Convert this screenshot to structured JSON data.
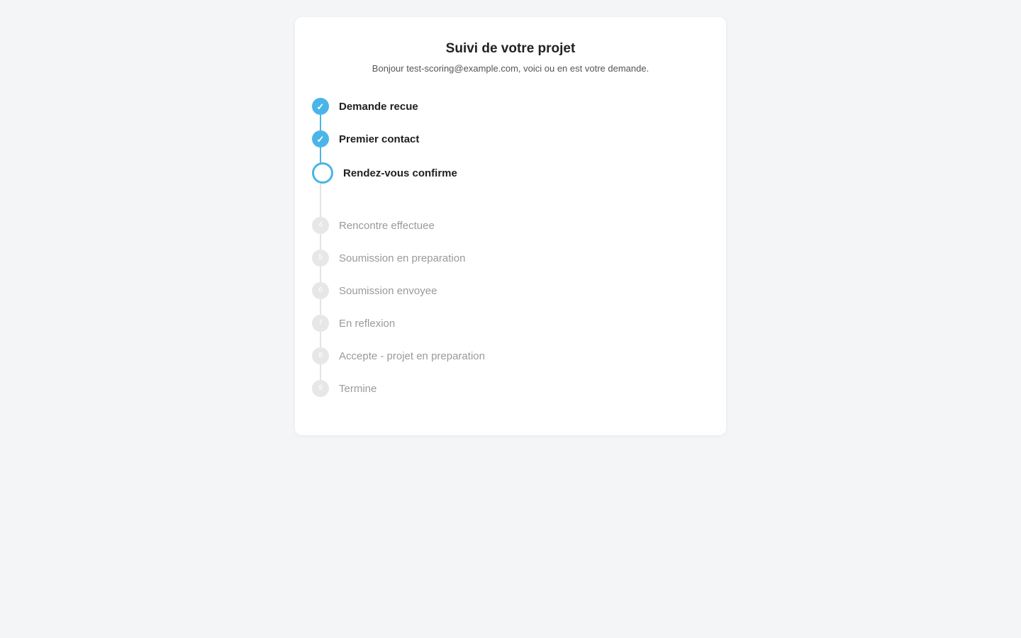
{
  "page": {
    "title": "Suivi de votre projet",
    "subtitle": "Bonjour test-scoring@example.com, voici ou en est votre demande."
  },
  "colors": {
    "accent": "#4ab5e8",
    "background": "#f4f5f7",
    "card": "#ffffff",
    "inactive_dot": "#e7e7e7",
    "inactive_text": "#9a9a9a"
  },
  "steps": [
    {
      "label": "Demande recue",
      "status": "done",
      "marker": "✓",
      "icon": "check-icon"
    },
    {
      "label": "Premier contact",
      "status": "done",
      "marker": "✓",
      "icon": "check-icon"
    },
    {
      "label": "Rendez-vous confirme",
      "status": "current",
      "marker": "",
      "icon": "ring-icon"
    },
    {
      "label": "Rencontre effectuee",
      "status": "todo",
      "marker": "4"
    },
    {
      "label": "Soumission en preparation",
      "status": "todo",
      "marker": "5"
    },
    {
      "label": "Soumission envoyee",
      "status": "todo",
      "marker": "6"
    },
    {
      "label": "En reflexion",
      "status": "todo",
      "marker": "7"
    },
    {
      "label": "Accepte - projet en preparation",
      "status": "todo",
      "marker": "8"
    },
    {
      "label": "Termine",
      "status": "todo",
      "marker": "9"
    }
  ]
}
